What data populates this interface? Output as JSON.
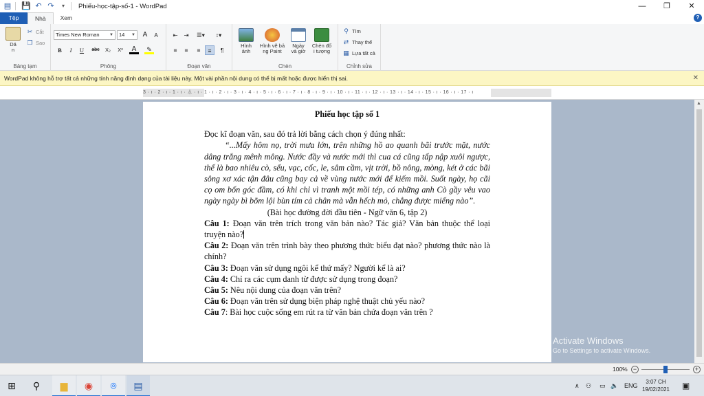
{
  "window": {
    "title": "Phiếu-học-tập-số-1 - WordPad",
    "minimize": "—",
    "maximize": "❐",
    "close": "✕"
  },
  "quick_access": [
    "save-icon",
    "undo-icon",
    "redo-icon",
    "customize-icon"
  ],
  "tabs": {
    "file": "Tệp",
    "home": "Nhà",
    "view": "Xem"
  },
  "ribbon": {
    "clipboard": {
      "label": "Bảng tạm",
      "paste": "Dá\nn",
      "cut": "Cắt",
      "copy": "Sao"
    },
    "font": {
      "label": "Phông",
      "family": "Times New Roman",
      "size": "14",
      "grow": "A",
      "shrink": "A",
      "bold": "B",
      "italic": "I",
      "underline": "U",
      "strike": "abc",
      "subscript": "X₂",
      "superscript": "X²",
      "color": "A"
    },
    "paragraph": {
      "label": "Đoạn văn"
    },
    "insert": {
      "label": "Chèn",
      "picture": "Hình\nảnh",
      "paint": "Hình vẽ bả\nng Paint",
      "datetime": "Ngày\nvà giờ",
      "object": "Chèn đố\ni tượng"
    },
    "editing": {
      "label": "Chỉnh sửa",
      "find": "Tìm",
      "replace": "Thay thế",
      "select_all": "Lựa tất cả"
    }
  },
  "infobar": {
    "message": "WordPad không hỗ trợ tất cả những tính năng định dạng của tài liệu này. Một vài phần nội dung có thể bị mất hoặc được hiển thị sai.",
    "close": "✕"
  },
  "ruler": {
    "labels": "3 · ı · 2 · ı · 1 · ı · ⏃ · ı · 1 · ı · 2 · ı · 3 · ı · 4 · ı · 5 · ı · 6 · ı · 7 · ı · 8 · ı · 9 · ı · 10 · ı · 11 · ı · 12 · ı · 13 · ı · 14 · ı · 15 · ı · 16 · ı · 17 · ı"
  },
  "document": {
    "title": "Phiếu học tập số 1",
    "intro": "Đọc kĩ đoạn văn, sau đó trả lời bằng cách chọn ý đúng nhất:",
    "passage": "“...Mấy hôm nọ, trời mưa lớn, trên những hồ ao quanh bãi trước mặt, nước dâng trắng mênh mông. Nước đầy và nước mới thì cua cá cũng tấp nập xuôi ngược, thế là bao nhiêu cò, sếu, vạc, cốc, le, sâm cầm, vịt trời, bồ nông, mòng, két ở các bãi sông xơ xác tận đâu cũng bay cả về vùng nước mới để kiếm mồi. Suốt ngày, họ cãi cọ om bốn góc đầm, có khi chỉ vì tranh một mồi tép, có những anh Cò gầy vêu vao ngày ngày bì bõm lội bùn tím cả chân mà vẫn hếch mỏ, chẳng được miếng nào”.",
    "source": "(Bài học đường đời đầu tiên - Ngữ văn 6, tập 2)",
    "questions": [
      {
        "label": "Câu 1:",
        "text": " Đoạn văn trên trích trong văn bản nào? Tác giả? Văn bản thuộc thể loại truyện nào?"
      },
      {
        "label": "Câu 2:",
        "text": " Đoạn văn trên trình bày theo phương thức biểu đạt nào? phương thức nào là chính?"
      },
      {
        "label": "Câu 3:",
        "text": " Đoạn văn sử dụng ngôi kể thứ mấy? Người kể là ai?"
      },
      {
        "label": "Câu 4:",
        "text": " Chỉ ra các cụm danh từ được sử dụng trong đoạn?"
      },
      {
        "label": "Câu 5:",
        "text": " Nêu nội dung của đoạn văn trên?"
      },
      {
        "label": "Câu 6:",
        "text": " Đoạn văn trên sử dụng biện pháp nghệ thuật chủ yếu nào?"
      },
      {
        "label": "Câu 7",
        "text": ": Bài học cuộc sống em rút ra từ văn bản chứa đoạn văn trên ?"
      }
    ]
  },
  "watermark": {
    "line1": "Activate Windows",
    "line2": "Go to Settings to activate Windows."
  },
  "statusbar": {
    "zoom": "100%",
    "zoom_level": 1.0
  },
  "taskbar": {
    "language": "ENG",
    "time": "3:07 CH",
    "date": "19/02/2021",
    "apps": [
      "windows-start-icon",
      "search-icon",
      "file-explorer-icon",
      "chrome-icon",
      "zalo-icon",
      "wordpad-icon"
    ]
  }
}
